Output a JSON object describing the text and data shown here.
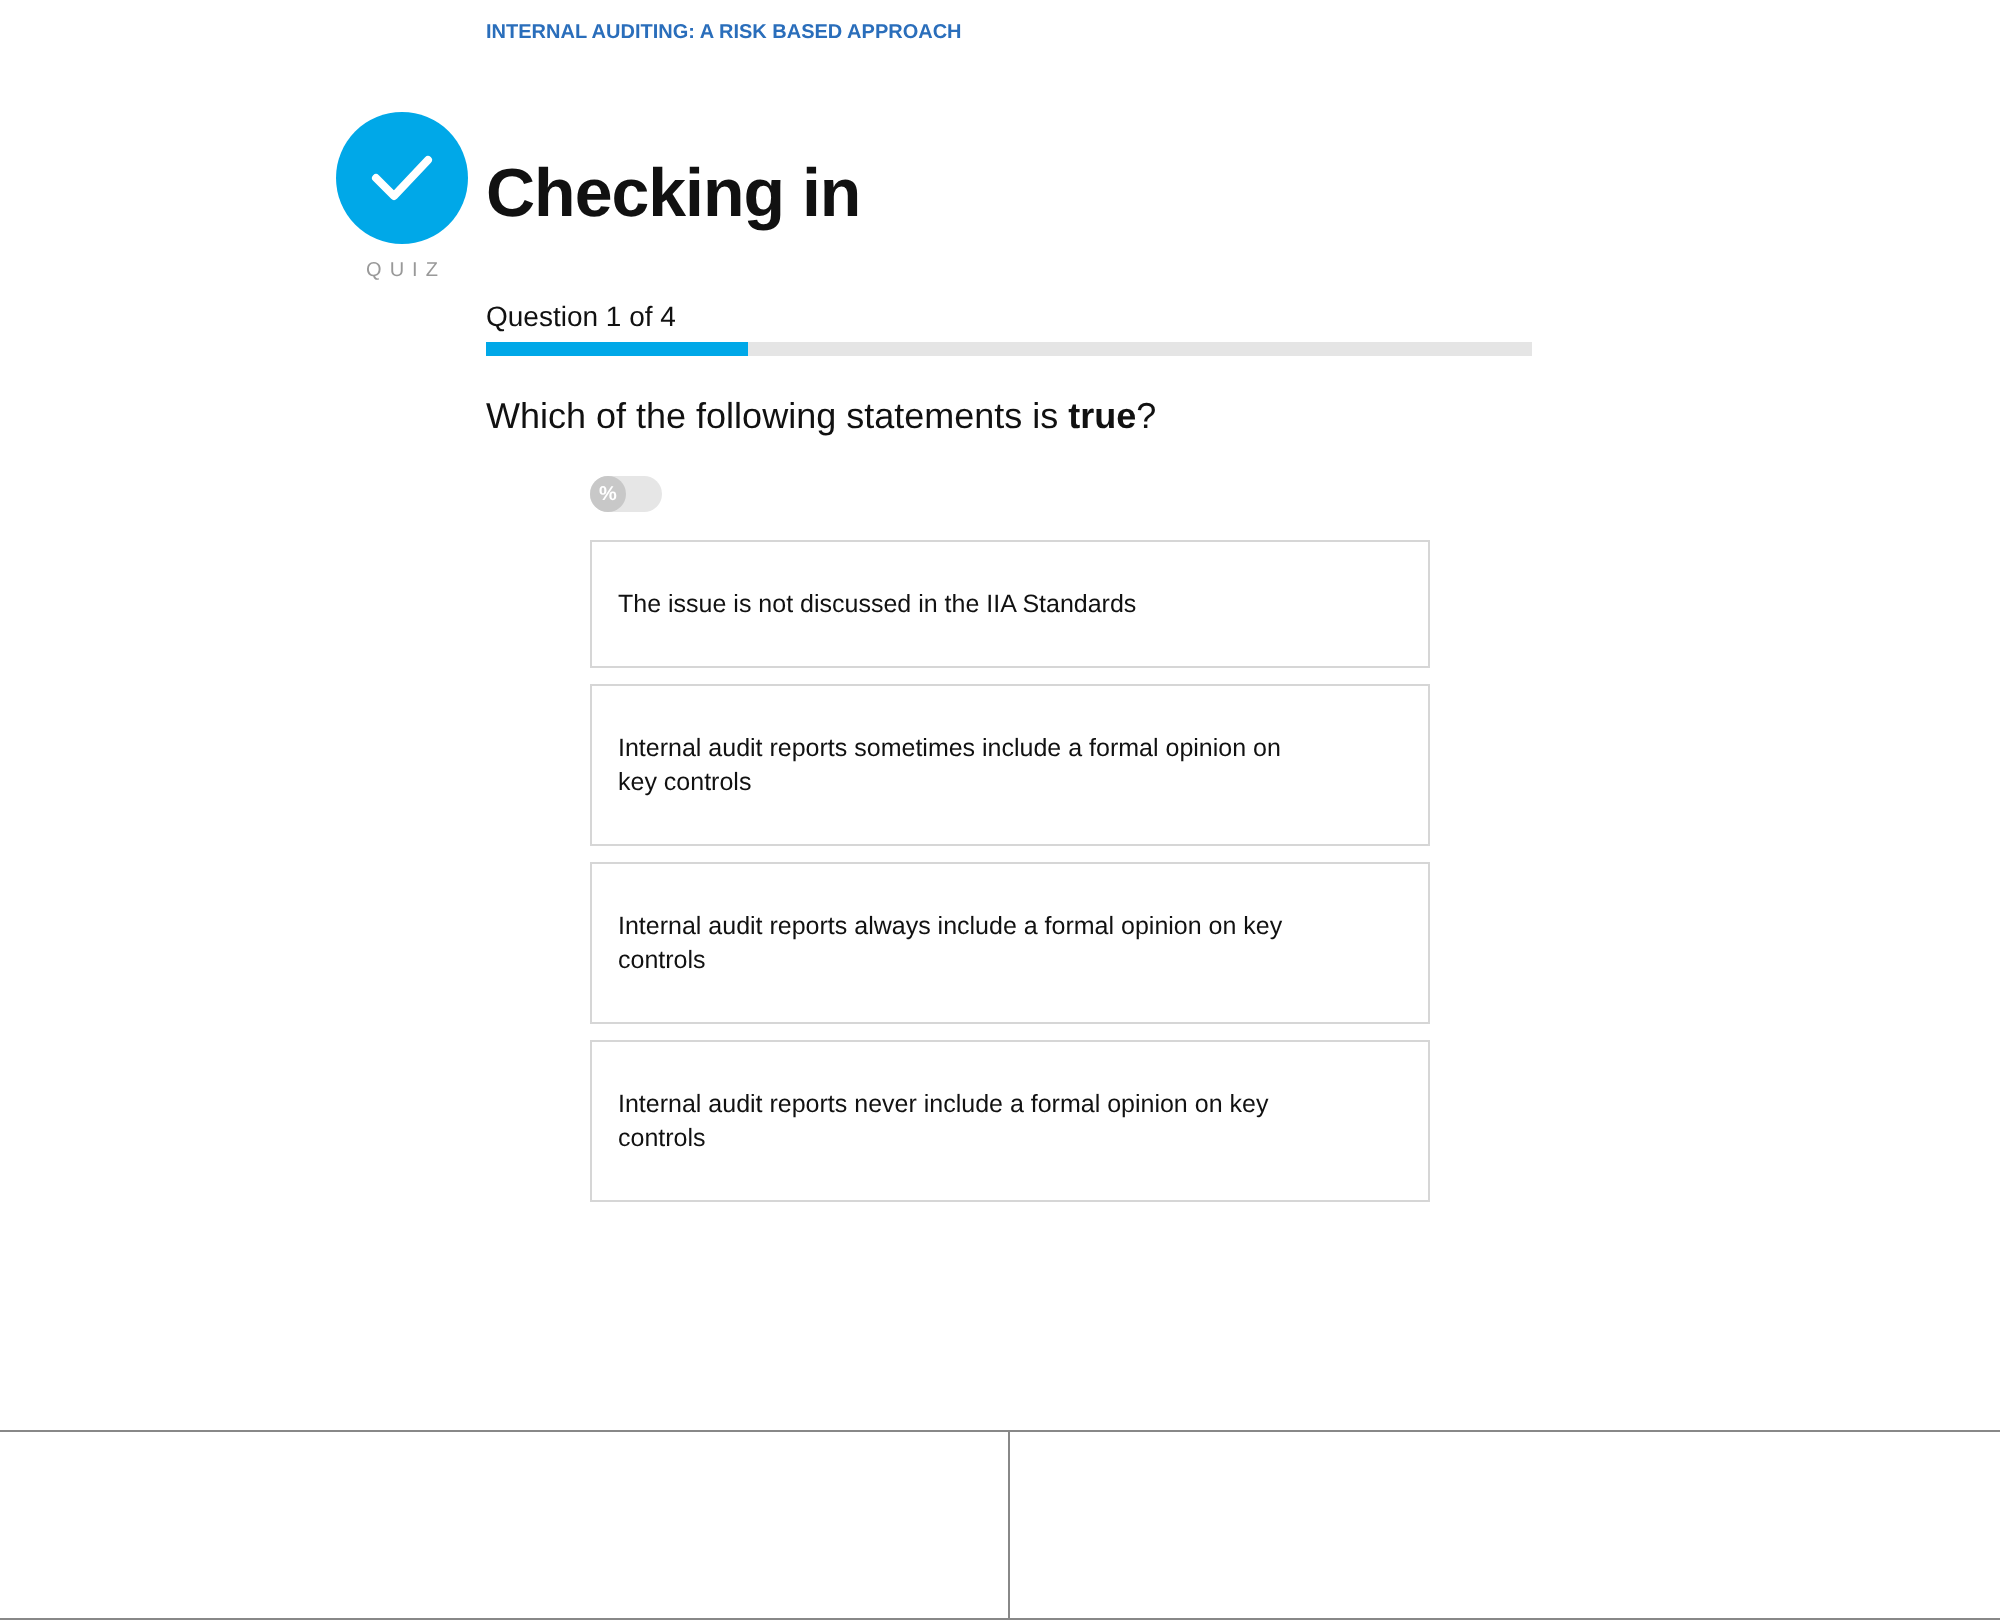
{
  "course_title": "INTERNAL AUDITING: A RISK BASED APPROACH",
  "badge": {
    "label": "QUIZ"
  },
  "title": "Checking in",
  "progress": {
    "label": "Question 1 of 4",
    "level": 0.25
  },
  "question": "Which of the following statements is **true**?",
  "percent_toggle": {
    "label": "%",
    "on": false
  },
  "options": [
    {
      "text": "The issue is not discussed in the IIA Standards",
      "selected": false
    },
    {
      "text": "Internal audit reports sometimes include a formal opinion on key controls",
      "selected": false
    },
    {
      "text": "Internal audit reports always include a formal opinion on key controls",
      "selected": false
    },
    {
      "text": "Internal audit reports never include a formal opinion on key controls",
      "selected": false
    }
  ]
}
